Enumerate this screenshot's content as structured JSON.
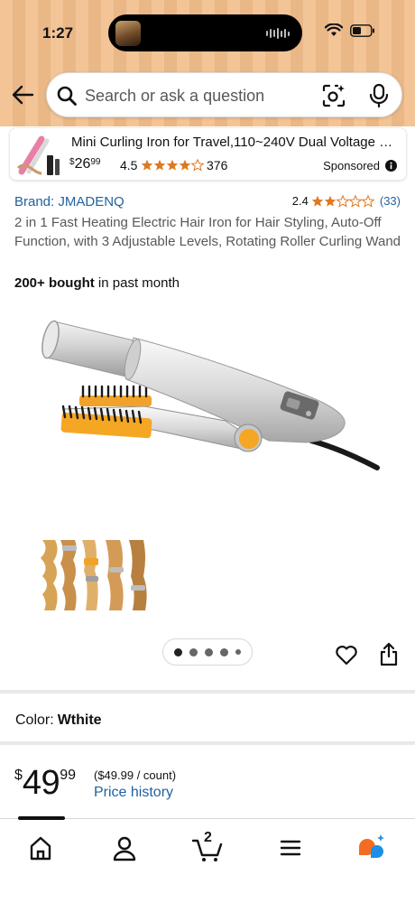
{
  "status_bar": {
    "time": "1:27"
  },
  "search": {
    "placeholder": "Search or ask a question"
  },
  "ad": {
    "title": "Mini Curling Iron for Travel,110~240V Dual Voltage with...",
    "price_symbol": "$",
    "price_whole": "26",
    "price_fraction": "99",
    "rating": "4.5",
    "rating_count": "376",
    "sponsored_label": "Sponsored"
  },
  "product": {
    "brand": "Brand: JMADENQ",
    "rating": "2.4",
    "rating_count": "(33)",
    "title": "2 in 1 Fast Heating Electric Hair Iron for Hair Styling, Auto-Off Function, with 3 Adjustable Levels, Rotating Roller Curling Wand",
    "bought_bold": "200+ bought",
    "bought_rest": " in past month",
    "image_count": 5,
    "active_image": 1,
    "color_label": "Color:",
    "color_value": "Wthite",
    "price_symbol": "$",
    "price_whole": "49",
    "price_fraction": "99",
    "unit_price": "($49.99 / count)",
    "price_history": "Price history"
  },
  "bottom_nav": {
    "items": [
      "home-icon",
      "account-icon",
      "cart-icon",
      "menu-icon",
      "rufus-icon"
    ],
    "cart_count": "2"
  },
  "colors": {
    "header_bg": "#f2bd8a",
    "link": "#2162a1",
    "star": "#de7921",
    "accent_orange": "#f0a22a",
    "rufus_blue": "#1f8fe5"
  }
}
